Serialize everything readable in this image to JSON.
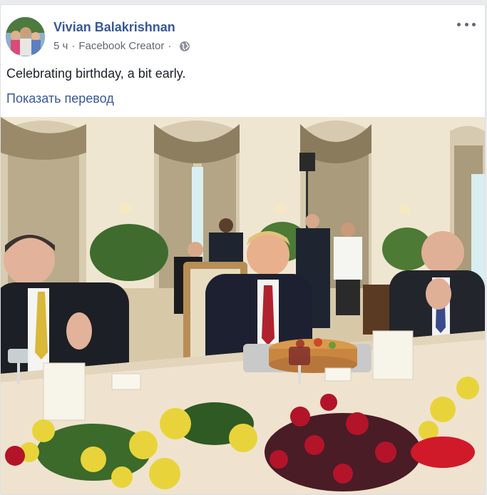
{
  "post": {
    "author": "Vivian Balakrishnan",
    "time": "5 ч",
    "separator": "·",
    "role": "Facebook Creator",
    "audience_icon": "globe-icon",
    "text": "Celebrating birthday, a bit early.",
    "translate_label": "Показать перевод",
    "menu_icon": "more-options-icon"
  },
  "colors": {
    "link": "#385898",
    "meta": "#606770",
    "text": "#1d2129"
  }
}
